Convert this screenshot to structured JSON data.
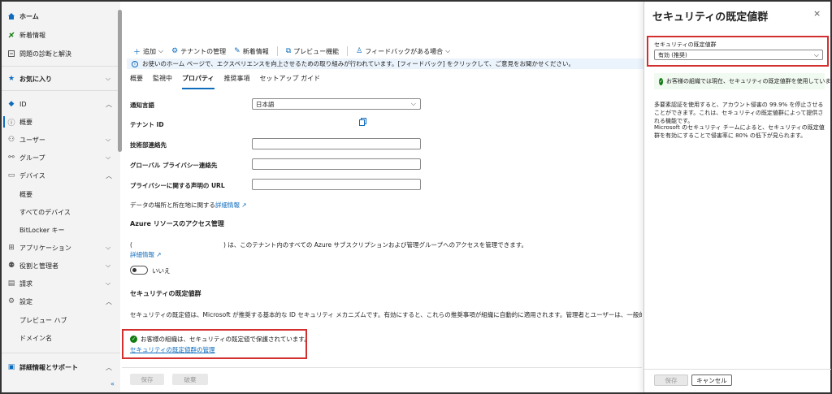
{
  "sidebar": {
    "items": [
      {
        "label": "ホーム",
        "icon": "home-icon",
        "bold": true
      },
      {
        "label": "新着情報",
        "icon": "megaphone-icon"
      },
      {
        "label": "問題の診断と解決",
        "icon": "wrench-icon"
      },
      {
        "label": "お気に入り",
        "icon": "star-icon",
        "bold": true
      },
      {
        "label": "ID",
        "icon": "diamond-icon"
      },
      {
        "label": "概要",
        "icon": "info-icon"
      },
      {
        "label": "ユーザー",
        "icon": "person-icon"
      },
      {
        "label": "グループ",
        "icon": "group-icon"
      },
      {
        "label": "デバイス",
        "icon": "devices-icon"
      },
      {
        "label": "概要"
      },
      {
        "label": "すべてのデバイス"
      },
      {
        "label": "BitLocker キー"
      },
      {
        "label": "アプリケーション",
        "icon": "apps-icon"
      },
      {
        "label": "役割と管理者",
        "icon": "roles-icon"
      },
      {
        "label": "請求",
        "icon": "billing-icon"
      },
      {
        "label": "設定",
        "icon": "gear-icon"
      },
      {
        "label": "プレビュー ハブ"
      },
      {
        "label": "ドメイン名"
      },
      {
        "label": "詳細情報とサポート",
        "icon": "support-icon",
        "bold": true
      }
    ],
    "collapse": "«"
  },
  "toolbar": {
    "add": "追加",
    "manage_tenant": "テナントの管理",
    "whats_new": "新着情報",
    "preview": "プレビュー機能",
    "feedback": "フィードバックがある場合"
  },
  "info_bar": "お使いのホーム ページで、エクスペリエンスを向上させるための取り組みが行われています。[フィードバック] をクリックして、ご意見をお聞かせください。",
  "tabs": [
    "概要",
    "監視中",
    "プロパティ",
    "推奨事項",
    "セットアップ ガイド"
  ],
  "fields": {
    "notification_language_label": "通知言語",
    "notification_language_value": "日本語",
    "tenant_id_label": "テナント ID",
    "technical_contact_label": "技術部連絡先",
    "global_privacy_label": "グローバル プライバシー連絡先",
    "privacy_url_label": "プライバシーに関する声明の URL"
  },
  "data_location": {
    "text": "データの場所と所在地に関する",
    "link": "詳細情報",
    "ext": "↗"
  },
  "azure_access": {
    "title": "Azure リソースのアクセス管理",
    "paren_open": "(",
    "text": ") は、このテナント内のすべての Azure サブスクリプションおよび管理グループへのアクセスを管理できます。",
    "link": "詳細情報",
    "ext": "↗",
    "toggle_label": "いいえ"
  },
  "security_defaults": {
    "title": "セキュリティの既定値群",
    "description": "セキュリティの既定値は、Microsoft が推奨する基本的な ID セキュリティ メカニズムです。有効にすると、これらの推奨事項が組織に自動的に適用されます。管理者とユーザーは、一般的な ID 関連の攻撃",
    "status": "お客様の組織は、セキュリティの既定値で保護されています。",
    "manage_link": "セキュリティの既定値群の管理"
  },
  "main_buttons": {
    "save": "保存",
    "discard": "破棄"
  },
  "panel": {
    "title": "セキュリティの既定値群",
    "close": "×",
    "label": "セキュリティの既定値群",
    "select_value": "有効 (推奨)",
    "success": "お客様の組織では現在、セキュリティの既定値群を使用しています。",
    "para1": "多要素認証を使用すると、アカウント侵害の 99.9% を停止させることができます。これは、セキュリティの既定値群によって提供される機能です。",
    "para2": "Microsoft のセキュリティ チームによると、セキュリティの既定値群を有効にすることで侵害率に 80% の低下が見られます。",
    "save": "保存",
    "cancel": "キャンセル"
  },
  "colors": {
    "accent": "#0f6cbd",
    "success": "#107c10",
    "highlight": "#d32f2f"
  }
}
